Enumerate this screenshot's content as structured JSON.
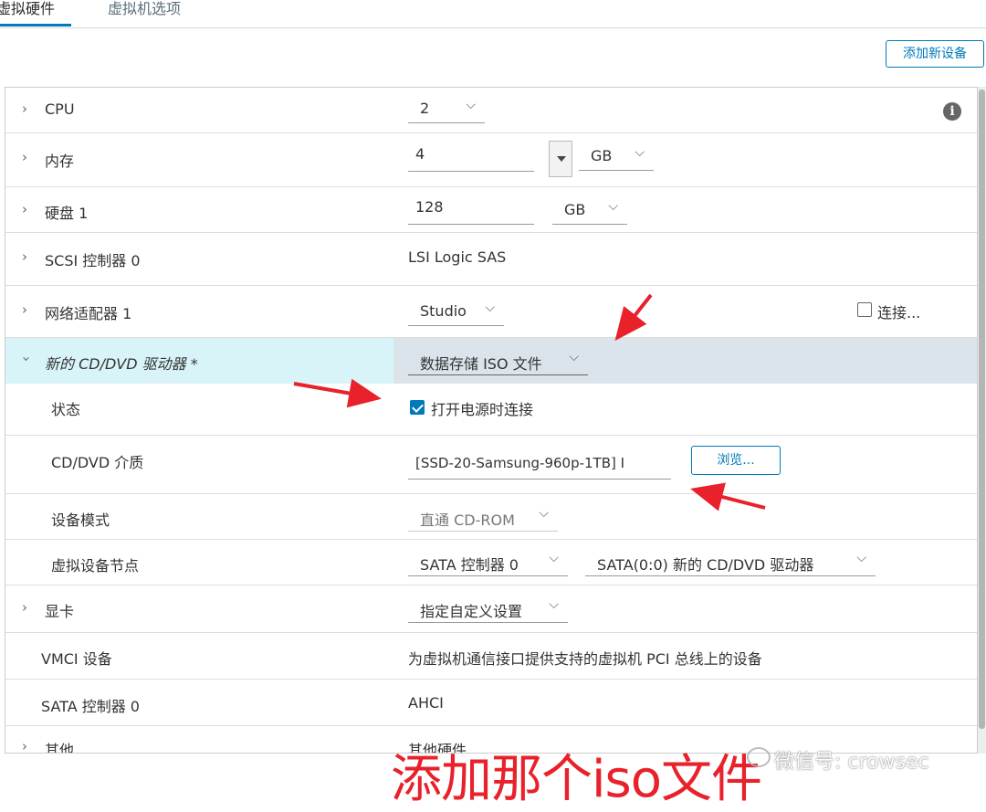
{
  "tabs": [
    {
      "label": "虚拟硬件",
      "active": true
    },
    {
      "label": "虚拟机选项",
      "active": false
    }
  ],
  "toolbar": {
    "add_device_label": "添加新设备"
  },
  "rows": {
    "cpu": {
      "label": "CPU",
      "value": "2"
    },
    "memory": {
      "label": "内存",
      "value": "4",
      "unit": "GB"
    },
    "disk": {
      "label": "硬盘 1",
      "value": "128",
      "unit": "GB"
    },
    "scsi": {
      "label": "SCSI 控制器 0",
      "value": "LSI Logic SAS"
    },
    "network": {
      "label": "网络适配器 1",
      "value": "Studio",
      "connect_label": "连接..."
    },
    "cdrom": {
      "label": "新的 CD/DVD 驱动器 *",
      "value": "数据存储 ISO 文件",
      "status_label": "状态",
      "status_checkbox_label": "打开电源时连接",
      "media_label": "CD/DVD 介质",
      "media_value": "[SSD-20-Samsung-960p-1TB] I",
      "browse_label": "浏览...",
      "mode_label": "设备模式",
      "mode_value": "直通 CD-ROM",
      "node_label": "虚拟设备节点",
      "node_controller": "SATA 控制器 0",
      "node_value": "SATA(0:0) 新的 CD/DVD 驱动器"
    },
    "video": {
      "label": "显卡",
      "value": "指定自定义设置"
    },
    "vmci": {
      "label": "VMCI 设备",
      "value": "为虚拟机通信接口提供支持的虚拟机 PCI 总线上的设备"
    },
    "sata": {
      "label": "SATA 控制器 0",
      "value": "AHCI"
    },
    "other": {
      "label": "其他",
      "value": "其他硬件"
    }
  },
  "annotation": {
    "caption": "添加那个iso文件",
    "watermark": "微信号: crowsec",
    "arrow_color": "#e8212b"
  },
  "colors": {
    "accent": "#0079b8",
    "highlight_left": "#d9f4f8",
    "highlight_right": "#dbe4ea"
  }
}
